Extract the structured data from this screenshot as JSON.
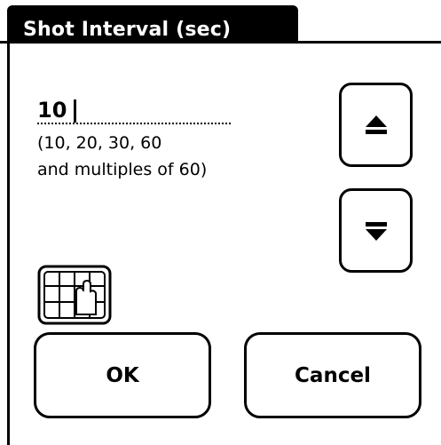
{
  "dialog": {
    "title": "Shot Interval (sec)"
  },
  "input": {
    "value": "10"
  },
  "hint": {
    "line1": "(10, 20, 30, 60",
    "line2": "and multiples of 60)"
  },
  "icons": {
    "increment": "up-arrow-icon",
    "decrement": "down-arrow-icon",
    "graffiti": "graffiti-shift-icon"
  },
  "buttons": {
    "ok": "OK",
    "cancel": "Cancel"
  }
}
